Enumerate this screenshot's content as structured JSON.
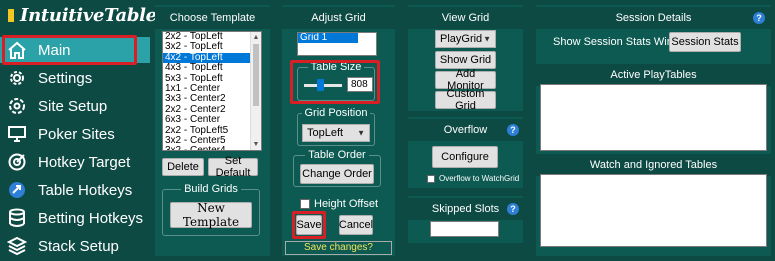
{
  "app": {
    "title": "IntuitiveTables"
  },
  "sidebar": {
    "items": [
      {
        "label": "Main",
        "icon": "home-icon"
      },
      {
        "label": "Settings",
        "icon": "gear-icon"
      },
      {
        "label": "Site Setup",
        "icon": "cog-icon"
      },
      {
        "label": "Poker Sites",
        "icon": "monitor-icon"
      },
      {
        "label": "Hotkey Target",
        "icon": "target-icon"
      },
      {
        "label": "Table Hotkeys",
        "icon": "arrow-circle-icon"
      },
      {
        "label": "Betting Hotkeys",
        "icon": "database-icon"
      },
      {
        "label": "Stack Setup",
        "icon": "stack-icon"
      }
    ]
  },
  "choose_template": {
    "title": "Choose Template",
    "templates": [
      "2x2 - TopLeft",
      "3x2 - TopLeft",
      "4x2 - TopLeft",
      "4x3 - TopLeft",
      "5x3 - TopLeft",
      "1x1 - Center",
      "3x3 - Center2",
      "2x2 - Center2",
      "6x3 - Center",
      "2x2 - TopLeft5",
      "3x2 - Center5",
      "3x2 - Center4"
    ],
    "selected_index": 2,
    "delete_label": "Delete",
    "set_default_label": "Set Default",
    "build_grids_label": "Build Grids",
    "new_template_label": "New Template"
  },
  "adjust_grid": {
    "title": "Adjust Grid",
    "grid_name": "Grid 1",
    "table_size_label": "Table Size",
    "table_size_value": "808",
    "grid_position_label": "Grid Position",
    "grid_position_value": "TopLeft",
    "table_order_label": "Table Order",
    "change_order_label": "Change Order",
    "height_offset_label": "Height Offset",
    "save_label": "Save",
    "cancel_label": "Cancel",
    "save_changes_label": "Save changes?"
  },
  "view_grid": {
    "title": "View Grid",
    "playgrid_value": "PlayGrid",
    "show_grid_label": "Show Grid",
    "add_monitor_label": "Add Monitor",
    "custom_grid_label": "Custom Grid"
  },
  "overflow": {
    "title": "Overflow",
    "configure_label": "Configure",
    "checkbox_label": "Overflow to WatchGrid"
  },
  "skipped_slots": {
    "title": "Skipped Slots"
  },
  "session": {
    "title": "Session Details",
    "show_label": "Show Session Stats Window:",
    "stats_button": "Session Stats",
    "active_title": "Active PlayTables",
    "watch_title": "Watch and Ignored Tables"
  },
  "colors": {
    "accent": "#2aa2a8",
    "highlight": "#d91f26",
    "panel": "#0c5a52",
    "background": "#0e4a44"
  }
}
